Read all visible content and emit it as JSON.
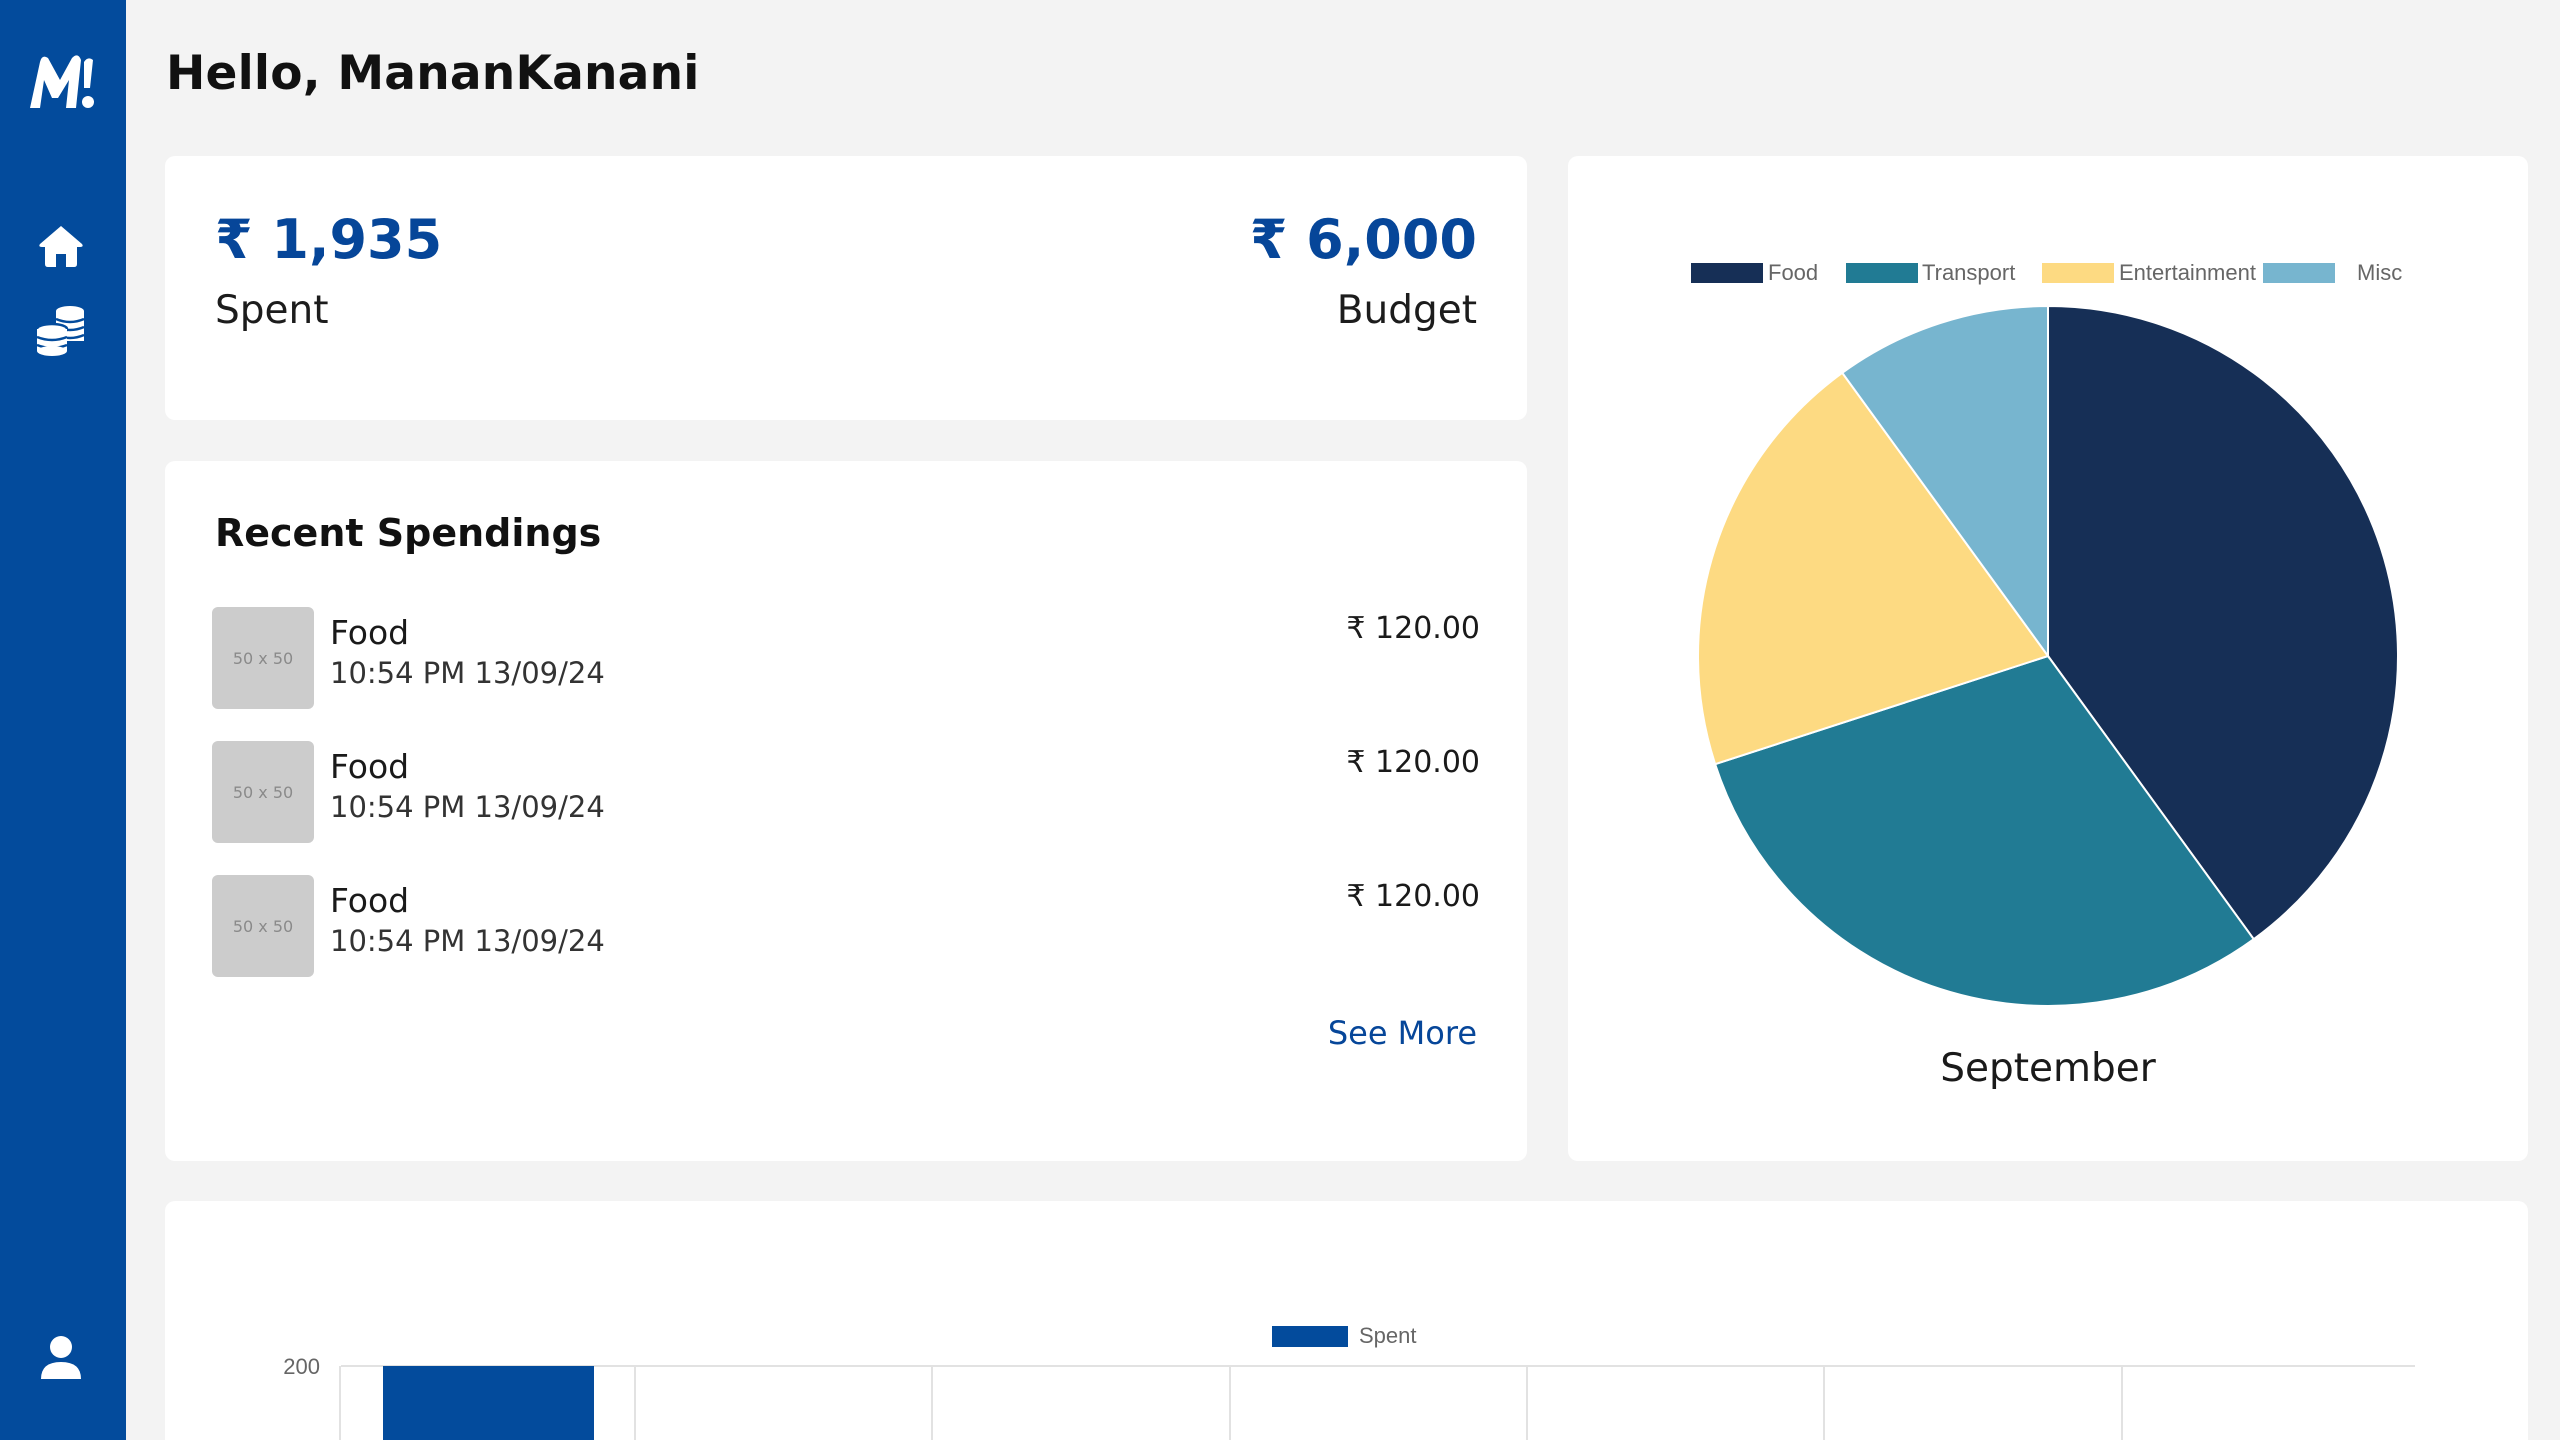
{
  "app": {
    "logo_icon": "m-logo-icon"
  },
  "sidebar": {
    "items": [
      {
        "icon": "home-icon"
      },
      {
        "icon": "coins-icon"
      }
    ],
    "bottom_icon": "user-icon"
  },
  "greeting": "Hello, MananKanani",
  "summary": {
    "spent_amount": "₹ 1,935",
    "spent_label": "Spent",
    "budget_amount": "₹ 6,000",
    "budget_label": "Budget"
  },
  "recent": {
    "title": "Recent Spendings",
    "items": [
      {
        "thumb": "50 x 50",
        "category": "Food",
        "time": "10:54 PM 13/09/24",
        "amount": "₹ 120.00"
      },
      {
        "thumb": "50 x 50",
        "category": "Food",
        "time": "10:54 PM 13/09/24",
        "amount": "₹ 120.00"
      },
      {
        "thumb": "50 x 50",
        "category": "Food",
        "time": "10:54 PM 13/09/24",
        "amount": "₹ 120.00"
      }
    ],
    "see_more": "See More"
  },
  "colors": {
    "brand": "#034b9c",
    "accent_text": "#064699",
    "food": "#162f56",
    "transport": "#217b94",
    "entertainment": "#fdda82",
    "misc": "#77b5cf"
  },
  "chart_data": [
    {
      "type": "pie",
      "categories": [
        "Food",
        "Transport",
        "Entertainment",
        "Misc"
      ],
      "values": [
        40,
        30,
        20,
        10
      ],
      "colors": [
        "#162f56",
        "#217b94",
        "#fdda82",
        "#77b5cf"
      ],
      "title": "",
      "caption": "September",
      "legend": "top"
    },
    {
      "type": "bar",
      "series": [
        {
          "name": "Spent",
          "color": "#034b9c",
          "values": [
            200
          ]
        }
      ],
      "y_ticks": [
        "200"
      ],
      "ylim": [
        0,
        200
      ],
      "legend": "top",
      "grid": true
    }
  ]
}
